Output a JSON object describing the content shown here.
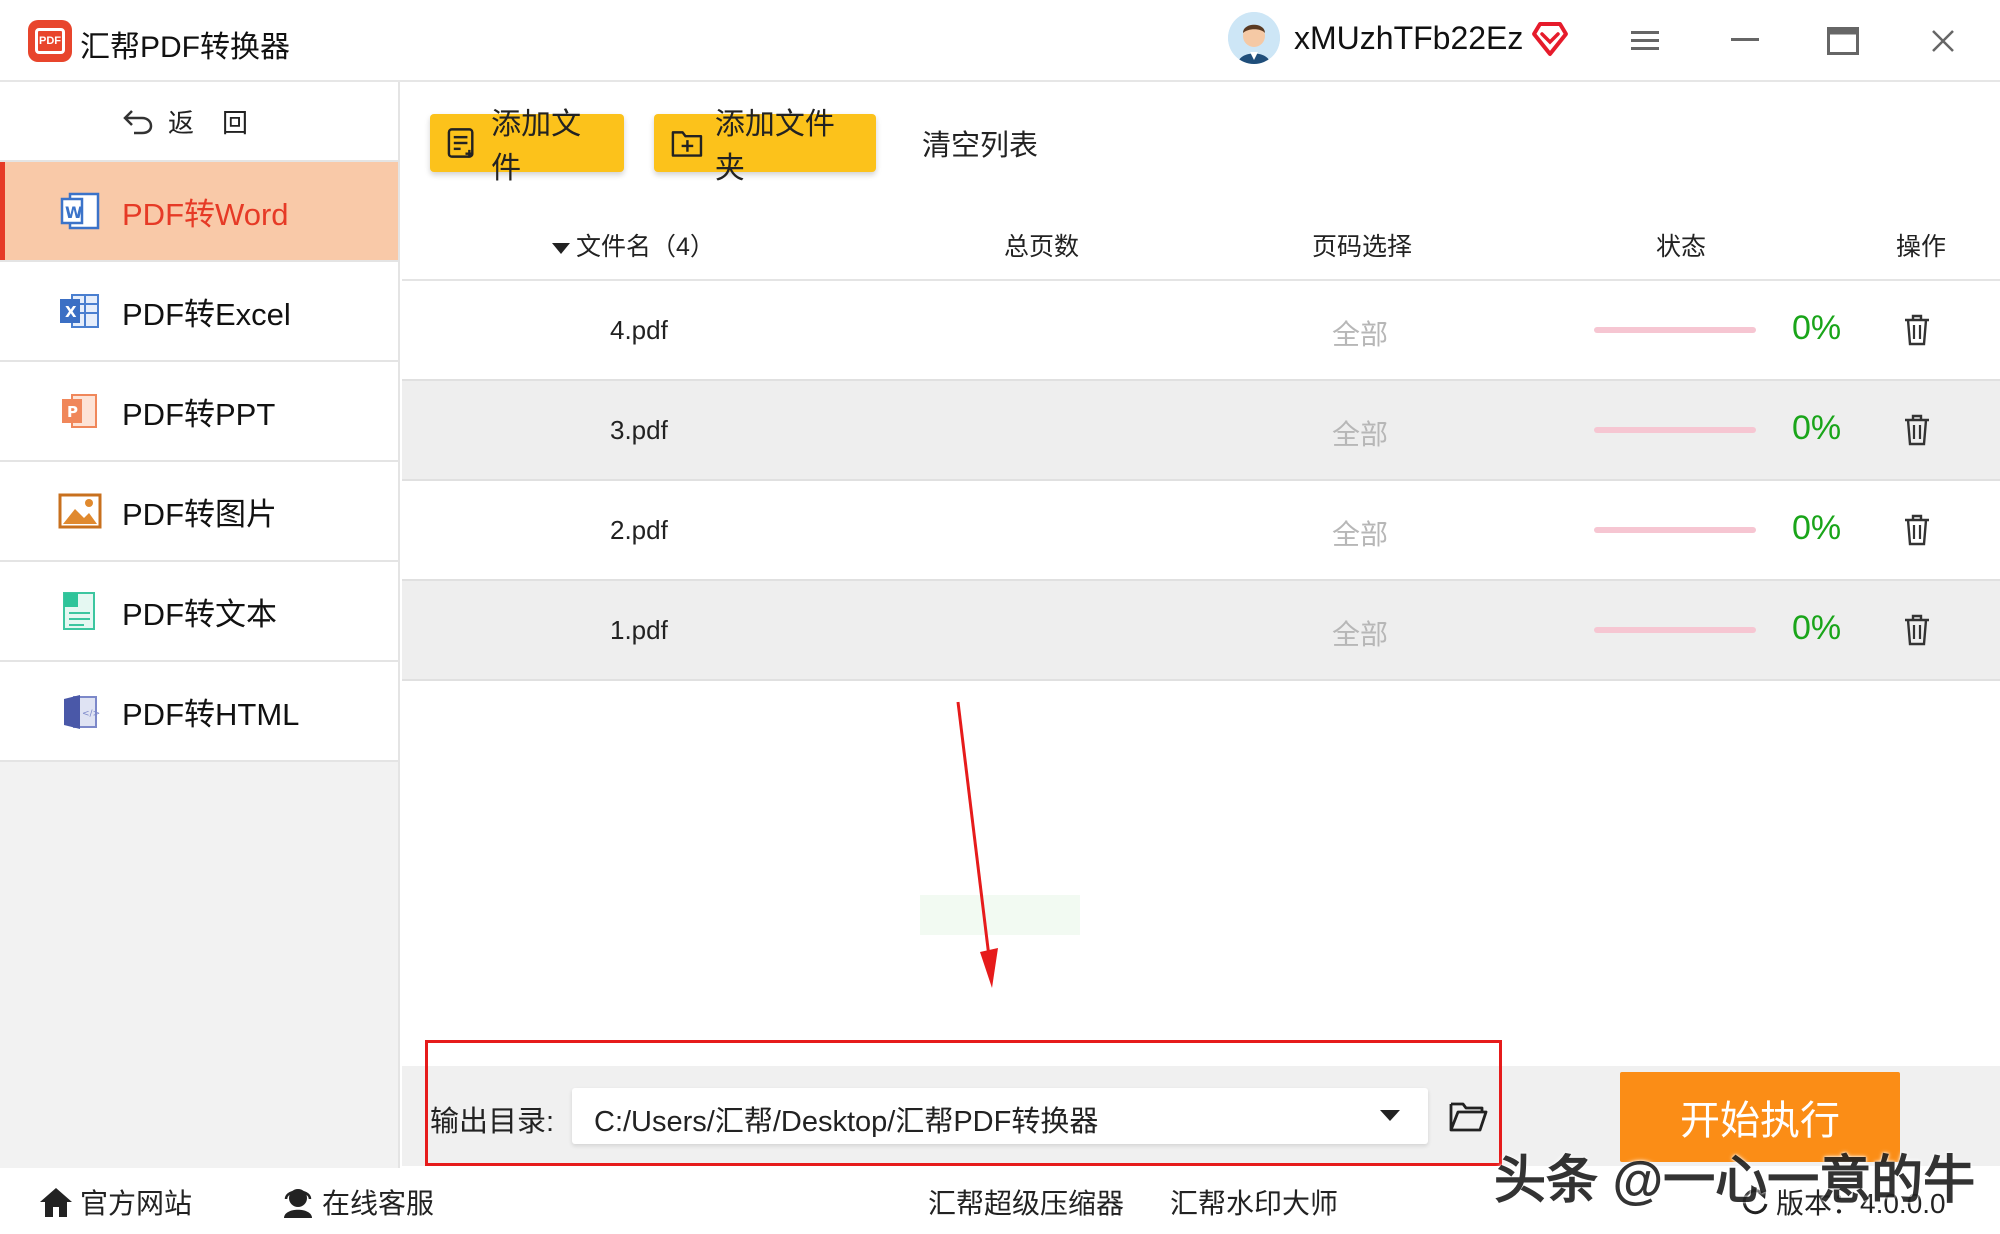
{
  "app": {
    "title": "汇帮PDF转换器",
    "username": "xMUzhTFb22Ez"
  },
  "colors": {
    "accent": "#e63a26",
    "active_bg": "#f9c9a8",
    "button_yellow": "#fcc21b",
    "start_orange": "#fb8d16",
    "percent_green": "#1aa51a",
    "progress_pink": "#f6c6d2"
  },
  "sidebar": {
    "back_label": "返回",
    "items": [
      {
        "label": "PDF转Word",
        "icon": "word-icon",
        "active": true
      },
      {
        "label": "PDF转Excel",
        "icon": "excel-icon",
        "active": false
      },
      {
        "label": "PDF转PPT",
        "icon": "ppt-icon",
        "active": false
      },
      {
        "label": "PDF转图片",
        "icon": "image-icon",
        "active": false
      },
      {
        "label": "PDF转文本",
        "icon": "text-icon",
        "active": false
      },
      {
        "label": "PDF转HTML",
        "icon": "html-icon",
        "active": false
      }
    ]
  },
  "toolbar": {
    "add_file": "添加文件",
    "add_folder": "添加文件夹",
    "clear_list": "清空列表"
  },
  "table": {
    "headers": {
      "filename": "文件名（4）",
      "pages": "总页数",
      "range": "页码选择",
      "status": "状态",
      "action": "操作"
    },
    "rows": [
      {
        "name": "4.pdf",
        "pages": "",
        "range": "全部",
        "progress": 0,
        "percent": "0%"
      },
      {
        "name": "3.pdf",
        "pages": "",
        "range": "全部",
        "progress": 0,
        "percent": "0%"
      },
      {
        "name": "2.pdf",
        "pages": "",
        "range": "全部",
        "progress": 0,
        "percent": "0%"
      },
      {
        "name": "1.pdf",
        "pages": "",
        "range": "全部",
        "progress": 0,
        "percent": "0%"
      }
    ]
  },
  "output": {
    "label": "输出目录:",
    "path": "C:/Users/汇帮/Desktop/汇帮PDF转换器",
    "start_button": "开始执行"
  },
  "footer": {
    "website": "官方网站",
    "support": "在线客服",
    "compressor": "汇帮超级压缩器",
    "watermark_master": "汇帮水印大师",
    "version": "版本：4.0.0.0"
  },
  "overlay_credit": "头条 @一心一意的牛"
}
